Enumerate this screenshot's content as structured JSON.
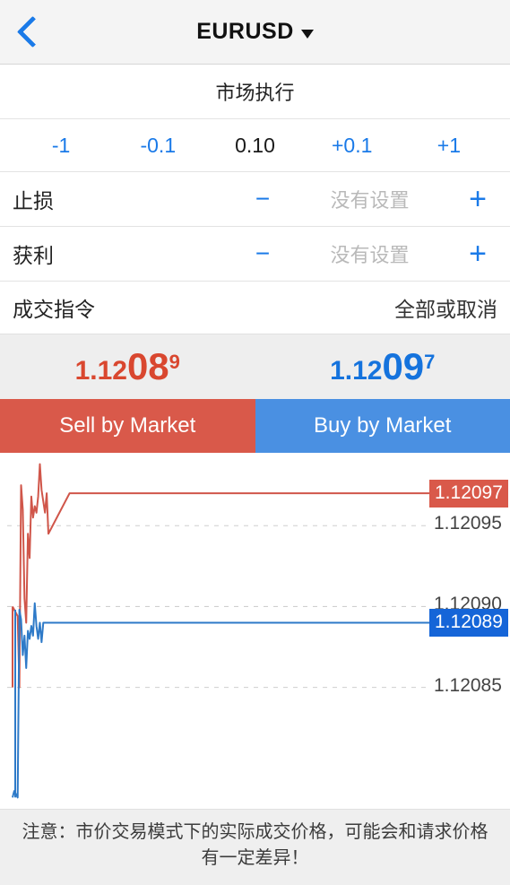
{
  "navbar": {
    "back_icon": "chevron-left-icon",
    "symbol": "EURUSD",
    "dropdown_icon": "caret-down-icon"
  },
  "execution_mode": "市场执行",
  "volume": {
    "dec_large": "-1",
    "dec_small": "-0.1",
    "value": "0.10",
    "inc_small": "+0.1",
    "inc_large": "+1"
  },
  "stop_loss": {
    "label": "止损",
    "minus": "−",
    "value": "没有设置",
    "plus": "+"
  },
  "take_profit": {
    "label": "获利",
    "minus": "−",
    "value": "没有设置",
    "plus": "+"
  },
  "fill_policy": {
    "label": "成交指令",
    "value": "全部或取消"
  },
  "quotes": {
    "bid": {
      "base": "1.12",
      "big": "08",
      "sup": "9",
      "color": "#d9472f"
    },
    "ask": {
      "base": "1.12",
      "big": "09",
      "sup": "7",
      "color": "#1573dd"
    }
  },
  "actions": {
    "sell": "Sell by Market",
    "buy": "Buy by Market",
    "sell_color": "#d9594a",
    "buy_color": "#4a90e2"
  },
  "footer_note": "注意：市价交易模式下的实际成交价格，可能会和请求价格有一定差异！",
  "chart_data": {
    "type": "line",
    "title": "",
    "xlabel": "",
    "ylabel": "",
    "grid": true,
    "legend": false,
    "ylim": [
      1.120775,
      1.120995
    ],
    "gridlines": [
      1.12095,
      1.1209,
      1.12085
    ],
    "tick_labels": [
      "1.12095",
      "1.12090",
      "1.12085"
    ],
    "current_labels": {
      "ask": "1.12097",
      "bid": "1.12089"
    },
    "series": [
      {
        "name": "ask",
        "color": "#d0564a",
        "last_value": 1.12097,
        "values": [
          1.1209,
          1.120898,
          1.120896,
          1.120894,
          1.12085,
          1.120975,
          1.12096,
          1.120905,
          1.12089,
          1.120945,
          1.12093,
          1.120968,
          1.120955,
          1.120962,
          1.120958,
          1.120968,
          1.120988,
          1.120972,
          1.120965,
          1.120958,
          1.12097,
          1.120945,
          1.12097,
          1.12097,
          1.12097,
          1.12097,
          1.12097,
          1.12097,
          1.12097,
          1.12097,
          1.12097,
          1.12097,
          1.12097,
          1.12097,
          1.12097,
          1.12097,
          1.12097,
          1.12097,
          1.12097,
          1.12097
        ]
      },
      {
        "name": "bid",
        "color": "#2e7ac8",
        "last_value": 1.12089,
        "values": [
          1.120782,
          1.120786,
          1.120784,
          1.120782,
          1.120898,
          1.120892,
          1.12087,
          1.120882,
          1.120862,
          1.120885,
          1.12088,
          1.120888,
          1.120882,
          1.120902,
          1.120888,
          1.12088,
          1.12089,
          1.120878,
          1.12089,
          1.12089,
          1.12089,
          1.12089,
          1.12089,
          1.12089,
          1.12089,
          1.12089,
          1.12089,
          1.12089,
          1.12089,
          1.12089,
          1.12089,
          1.12089,
          1.12089,
          1.12089,
          1.12089,
          1.12089,
          1.12089,
          1.12089,
          1.12089,
          1.12089
        ]
      }
    ]
  }
}
